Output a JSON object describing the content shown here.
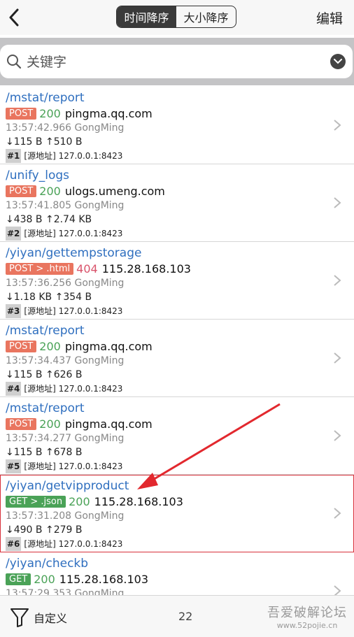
{
  "header": {
    "back_icon": "chevron-left-icon",
    "tabs": [
      {
        "label": "时间降序",
        "active": true
      },
      {
        "label": "大小降序",
        "active": false
      }
    ],
    "edit_label": "编辑"
  },
  "search": {
    "placeholder": "关键字",
    "filter_icon": "chevron-down-circle-icon"
  },
  "requests": [
    {
      "path": "/mstat/report",
      "method": "POST",
      "status": "200",
      "host": "pingma.qq.com",
      "time": "13:57:42.966",
      "user": "GongMing",
      "down": "↓115 B",
      "up": "↑510 B",
      "index": "#1",
      "source": "[源地址] 127.0.0.1:8423"
    },
    {
      "path": "/unify_logs",
      "method": "POST",
      "status": "200",
      "host": "ulogs.umeng.com",
      "time": "13:57:41.805",
      "user": "GongMing",
      "down": "↓438 B",
      "up": "↑2.74 KB",
      "index": "#2",
      "source": "[源地址] 127.0.0.1:8423"
    },
    {
      "path": "/yiyan/gettempstorage",
      "method": "POST > .html",
      "status": "404",
      "host": "115.28.168.103",
      "time": "13:57:36.256",
      "user": "GongMing",
      "down": "↓1.18 KB",
      "up": "↑354 B",
      "index": "#3",
      "source": "[源地址] 127.0.0.1:8423"
    },
    {
      "path": "/mstat/report",
      "method": "POST",
      "status": "200",
      "host": "pingma.qq.com",
      "time": "13:57:34.437",
      "user": "GongMing",
      "down": "↓115 B",
      "up": "↑626 B",
      "index": "#4",
      "source": "[源地址] 127.0.0.1:8423"
    },
    {
      "path": "/mstat/report",
      "method": "POST",
      "status": "200",
      "host": "pingma.qq.com",
      "time": "13:57:34.277",
      "user": "GongMing",
      "down": "↓115 B",
      "up": "↑678 B",
      "index": "#5",
      "source": "[源地址] 127.0.0.1:8423"
    },
    {
      "path": "/yiyan/getvipproduct",
      "method": "GET > .json",
      "status": "200",
      "host": "115.28.168.103",
      "time": "13:57:31.208",
      "user": "GongMing",
      "down": "↓490 B",
      "up": "↑279 B",
      "index": "#6",
      "source": "[源地址] 127.0.0.1:8423"
    },
    {
      "path": "/yiyan/checkb",
      "method": "GET",
      "status": "200",
      "host": "115.28.168.103",
      "time": "13:57:29.353",
      "user": "GongMing",
      "down": "",
      "up": "",
      "index": "",
      "source": ""
    }
  ],
  "footer": {
    "filter_icon": "funnel-icon",
    "custom_label": "自定义",
    "count": "22"
  },
  "watermark": {
    "line1": "吾爱破解论坛",
    "line2": "www.52pojie.cn"
  },
  "colors": {
    "link": "#2f6fbf",
    "post_badge": "#e9755f",
    "get_badge": "#4aa257",
    "status_ok": "#4aa257",
    "status_err": "#d9536b",
    "highlight": "#d8303a"
  }
}
